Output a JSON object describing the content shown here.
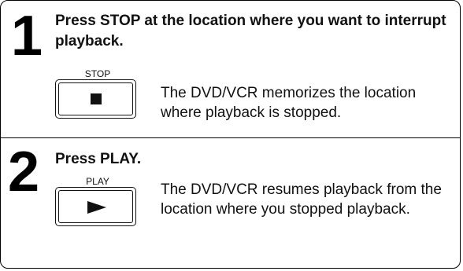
{
  "steps": [
    {
      "number": "1",
      "heading": "Press STOP at the location where you want to interrupt playback.",
      "button": {
        "label": "STOP",
        "icon": "stop-square-icon"
      },
      "description": "The DVD/VCR memorizes the location where playback is stopped."
    },
    {
      "number": "2",
      "heading": "Press PLAY.",
      "button": {
        "label": "PLAY",
        "icon": "play-triangle-icon"
      },
      "description": "The DVD/VCR resumes playback from the location where you stopped playback."
    }
  ]
}
